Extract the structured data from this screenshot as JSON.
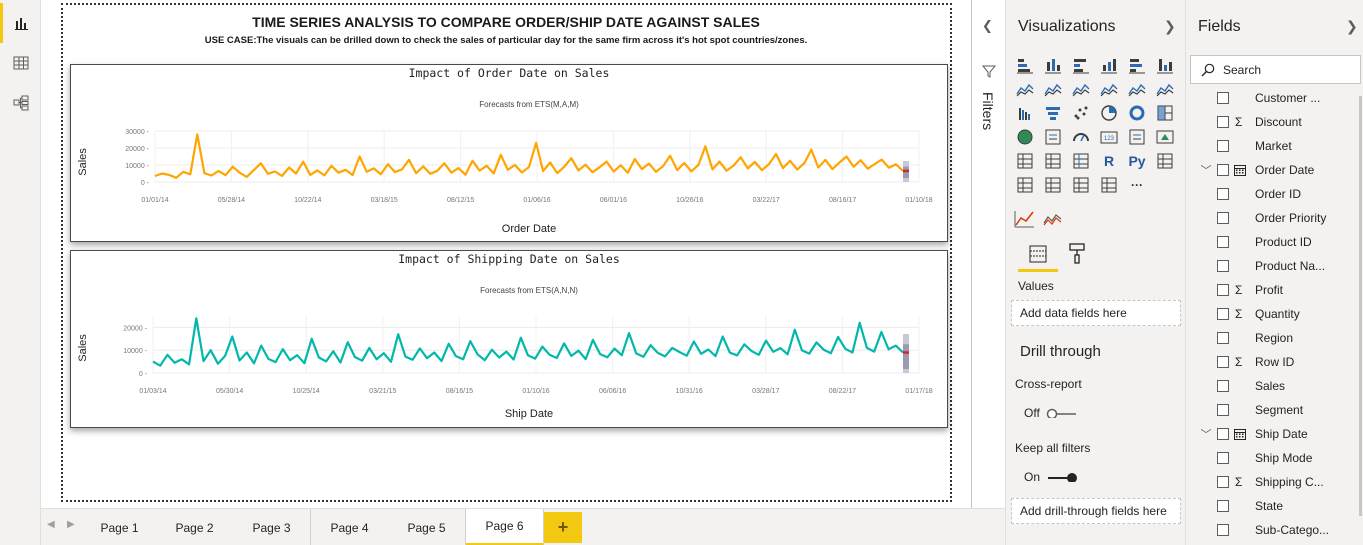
{
  "report": {
    "title": "TIME SERIES ANALYSIS TO COMPARE ORDER/SHIP DATE AGAINST SALES",
    "subtitle": "USE CASE:The visuals can be drilled down to check the sales of particular day for the same firm across it's hot spot countries/zones."
  },
  "chart_data": [
    {
      "type": "line",
      "title": "Impact of Order Date on Sales",
      "subtitle": "Forecasts from ETS(M,A,M)",
      "xlabel": "Order Date",
      "ylabel": "Sales",
      "x_ticks": [
        "01/01/14",
        "05/28/14",
        "10/22/14",
        "03/18/15",
        "08/12/15",
        "01/06/16",
        "06/01/16",
        "10/26/16",
        "03/22/17",
        "08/16/17",
        "01/10/18"
      ],
      "y_ticks": [
        0,
        10000,
        20000,
        30000
      ],
      "ylim": [
        0,
        30000
      ],
      "color": "#FFA500",
      "forecast_color": "#D62728",
      "grid": true,
      "series": [
        {
          "values": [
            3500,
            5000,
            4200,
            2500,
            6000,
            4500,
            28000,
            5200,
            3800,
            6500,
            4000,
            9000,
            5500,
            3000,
            7000,
            11000,
            4800,
            6200,
            3500,
            8500,
            5000,
            12000,
            4200,
            6800,
            3900,
            9500,
            5500,
            7200,
            4100,
            15000,
            6000,
            8000,
            4500,
            10500,
            5800,
            7500,
            13000,
            5200,
            9200,
            4800,
            6600,
            11000,
            5500,
            8200,
            4300,
            12500,
            6700,
            9500,
            5000,
            16000,
            7200,
            10000,
            5600,
            8800,
            23000,
            6400,
            11500,
            5200,
            9000,
            14000,
            6800,
            10200,
            5700,
            8700,
            12000,
            6200,
            9800,
            5400,
            13500,
            7600,
            10800,
            6000,
            9300,
            15500,
            7000,
            11200,
            6300,
            10000,
            21000,
            7400,
            12000,
            6600,
            9700,
            14500,
            8000,
            11800,
            7000,
            10500,
            16500,
            8200,
            12500,
            7300,
            11000,
            19000,
            8500,
            13000,
            7600,
            11500,
            15000,
            9000,
            12800,
            7800,
            10600,
            13200,
            8400,
            10400,
            6500
          ]
        }
      ]
    },
    {
      "type": "line",
      "title": "Impact of Shipping Date on Sales",
      "subtitle": "Forecasts from ETS(A,N,N)",
      "xlabel": "Ship Date",
      "ylabel": "Sales",
      "x_ticks": [
        "01/03/14",
        "05/30/14",
        "10/25/14",
        "03/21/15",
        "08/16/15",
        "01/10/16",
        "06/06/16",
        "10/31/16",
        "03/28/17",
        "08/22/17",
        "01/17/18"
      ],
      "y_ticks": [
        0,
        10000,
        20000
      ],
      "ylim": [
        0,
        25000
      ],
      "color": "#01B8AA",
      "forecast_color": "#D62728",
      "grid": true,
      "series": [
        {
          "values": [
            5000,
            3200,
            8000,
            4500,
            6000,
            3800,
            24000,
            5200,
            10000,
            4100,
            7500,
            16000,
            5500,
            9000,
            4200,
            12000,
            6200,
            4800,
            10500,
            5600,
            7800,
            4300,
            15000,
            6800,
            5100,
            9500,
            4600,
            13500,
            7000,
            5400,
            11000,
            6000,
            8700,
            4900,
            17000,
            7200,
            5800,
            10800,
            6500,
            9000,
            5200,
            12800,
            7400,
            6000,
            14000,
            8200,
            5600,
            10200,
            6800,
            9400,
            5900,
            15500,
            7700,
            6300,
            11600,
            8000,
            6600,
            13000,
            7500,
            9800,
            6100,
            14500,
            8300,
            6900,
            10700,
            7800,
            17500,
            8600,
            7100,
            12200,
            8800,
            7300,
            11000,
            9200,
            7600,
            13800,
            8400,
            10300,
            7400,
            16000,
            8900,
            7700,
            12600,
            9600,
            8000,
            14200,
            9300,
            10900,
            8200,
            19000,
            9900,
            8500,
            13400,
            10200,
            8700,
            15800,
            10600,
            9000,
            22000,
            11000,
            9400,
            18000,
            10400,
            12000,
            9000
          ]
        }
      ]
    }
  ],
  "tabs": [
    "Page 1",
    "Page 2",
    "Page 3",
    "Page 4",
    "Page 5",
    "Page 6"
  ],
  "active_tab": "Page 6",
  "add_tab": "+",
  "filters": {
    "label": "Filters"
  },
  "viz_pane": {
    "title": "Visualizations",
    "values_label": "Values",
    "values_drop": "Add data fields here",
    "drill_title": "Drill through",
    "cross_report_label": "Cross-report",
    "cross_report_state": "Off",
    "keep_filters_label": "Keep all filters",
    "keep_filters_state": "On",
    "drill_drop": "Add drill-through fields here",
    "r_label": "R",
    "py_label": "Py",
    "more_label": "···",
    "accent": "#F2C811"
  },
  "fields_pane": {
    "title": "Fields",
    "search_placeholder": "Search",
    "fields": [
      {
        "name": "Customer ...",
        "sigma": false,
        "table": false,
        "expand": ""
      },
      {
        "name": "Discount",
        "sigma": true,
        "table": false,
        "expand": ""
      },
      {
        "name": "Market",
        "sigma": false,
        "table": false,
        "expand": ""
      },
      {
        "name": "Order Date",
        "sigma": false,
        "table": true,
        "expand": "﹀"
      },
      {
        "name": "Order ID",
        "sigma": false,
        "table": false,
        "expand": ""
      },
      {
        "name": "Order Priority",
        "sigma": false,
        "table": false,
        "expand": ""
      },
      {
        "name": "Product ID",
        "sigma": false,
        "table": false,
        "expand": ""
      },
      {
        "name": "Product Na...",
        "sigma": false,
        "table": false,
        "expand": ""
      },
      {
        "name": "Profit",
        "sigma": true,
        "table": false,
        "expand": ""
      },
      {
        "name": "Quantity",
        "sigma": true,
        "table": false,
        "expand": ""
      },
      {
        "name": "Region",
        "sigma": false,
        "table": false,
        "expand": ""
      },
      {
        "name": "Row ID",
        "sigma": true,
        "table": false,
        "expand": ""
      },
      {
        "name": "Sales",
        "sigma": false,
        "table": false,
        "expand": ""
      },
      {
        "name": "Segment",
        "sigma": false,
        "table": false,
        "expand": ""
      },
      {
        "name": "Ship Date",
        "sigma": false,
        "table": true,
        "expand": "﹀"
      },
      {
        "name": "Ship Mode",
        "sigma": false,
        "table": false,
        "expand": ""
      },
      {
        "name": "Shipping C...",
        "sigma": true,
        "table": false,
        "expand": ""
      },
      {
        "name": "State",
        "sigma": false,
        "table": false,
        "expand": ""
      },
      {
        "name": "Sub-Catego...",
        "sigma": false,
        "table": false,
        "expand": ""
      }
    ]
  }
}
